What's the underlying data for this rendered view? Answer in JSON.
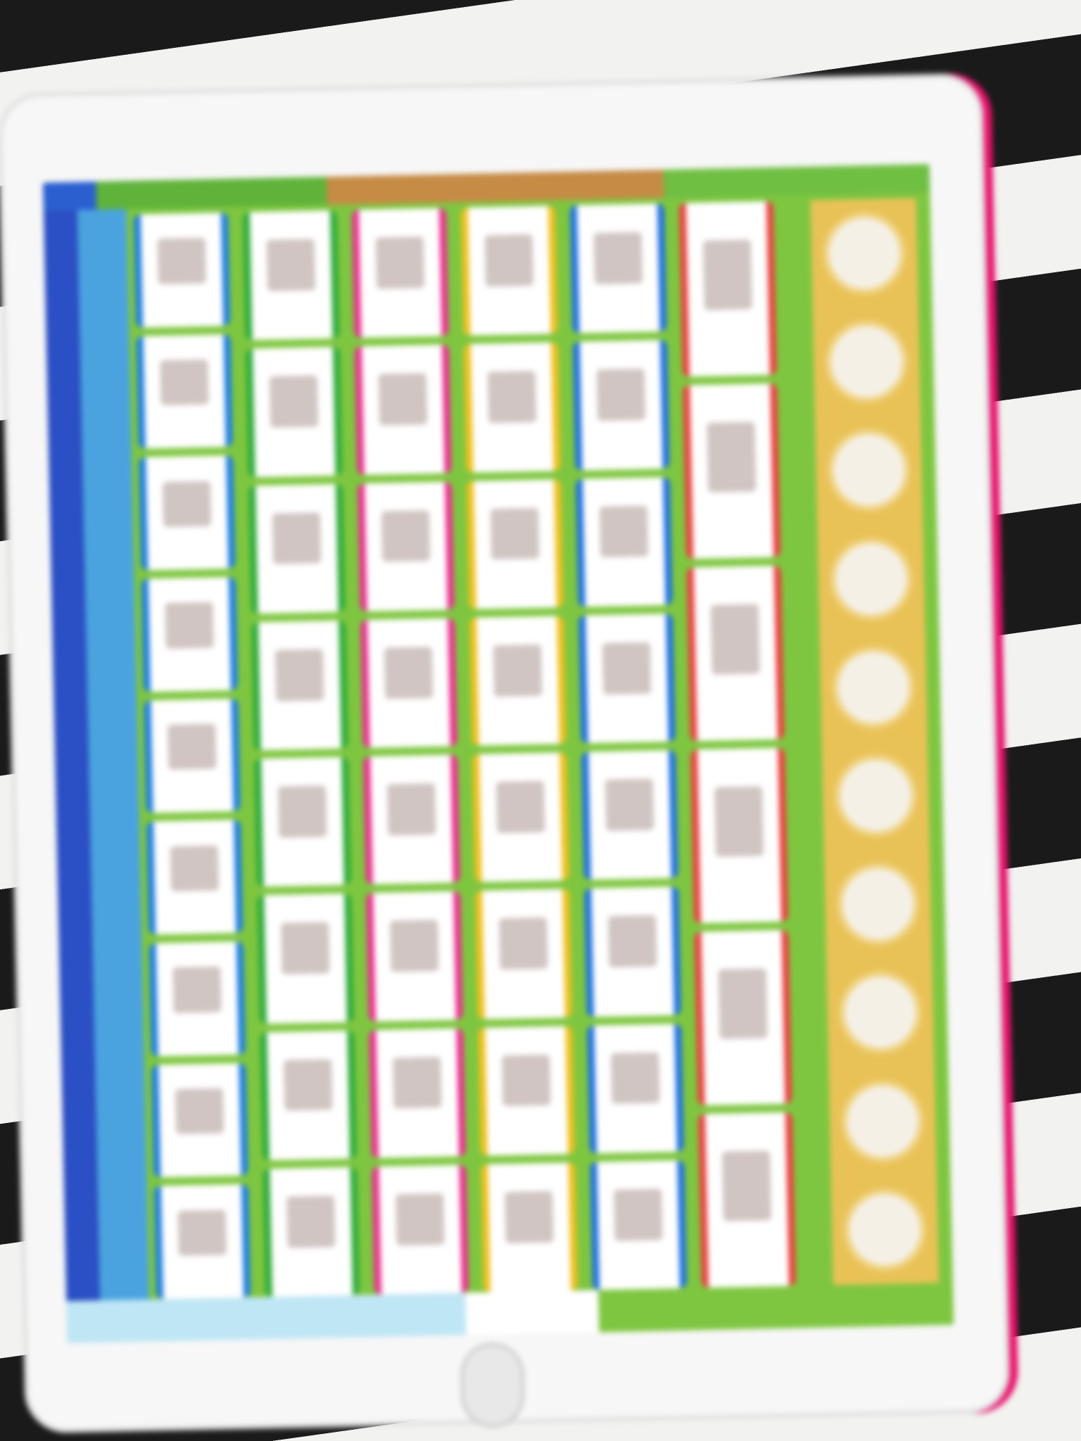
{
  "device": {
    "type": "toy learning tablet",
    "frame_color": "#f7f7f7",
    "accent_color": "#e8146c"
  },
  "screen": {
    "columns": [
      {
        "name": "column-1",
        "border_color": "#1e7de0",
        "cells": 9
      },
      {
        "name": "column-2",
        "border_color": "#2eaa3a",
        "cells": 8
      },
      {
        "name": "column-3",
        "border_color": "#e8308f",
        "cells": 8
      },
      {
        "name": "column-4",
        "border_color": "#f0c020",
        "cells": 8
      },
      {
        "name": "column-5",
        "border_color": "#1e6fe0",
        "cells": 8
      },
      {
        "name": "column-6",
        "border_color": "#e84040",
        "cells": 6
      }
    ],
    "circle_count": 10
  }
}
